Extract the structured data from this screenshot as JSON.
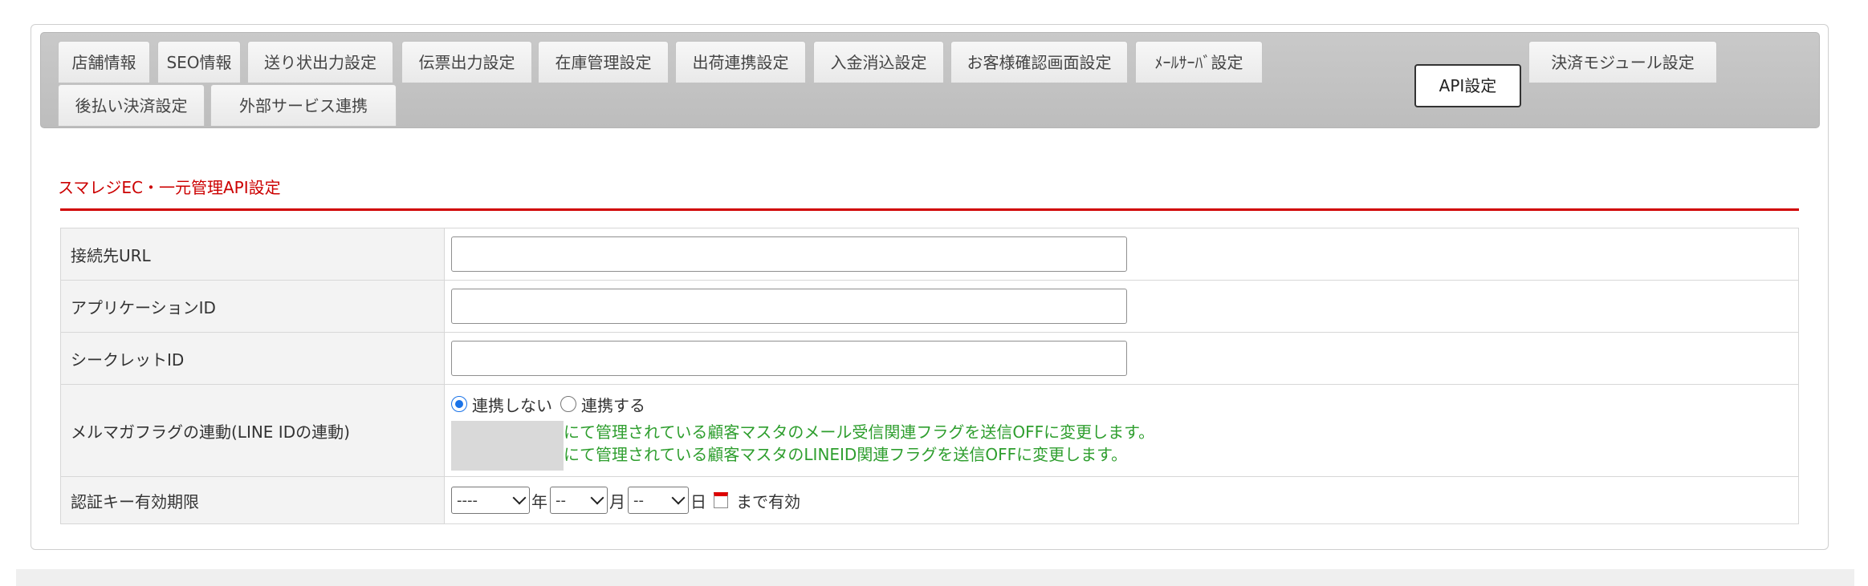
{
  "tabs": [
    {
      "label": "店舗情報",
      "active": false
    },
    {
      "label": "SEO情報",
      "active": false
    },
    {
      "label": "送り状出力設定",
      "active": false
    },
    {
      "label": "伝票出力設定",
      "active": false
    },
    {
      "label": "在庫管理設定",
      "active": false
    },
    {
      "label": "出荷連携設定",
      "active": false
    },
    {
      "label": "入金消込設定",
      "active": false
    },
    {
      "label": "お客様確認画面設定",
      "active": false
    },
    {
      "label": "ﾒｰﾙｻｰﾊﾞ設定",
      "active": false
    },
    {
      "label": "API設定",
      "active": true
    },
    {
      "label": "決済モジュール設定",
      "active": false
    },
    {
      "label": "後払い決済設定",
      "active": false
    },
    {
      "label": "外部サービス連携",
      "active": false
    }
  ],
  "section_title": "スマレジEC・一元管理API設定",
  "form": {
    "url_label": "接続先URL",
    "url_value": "",
    "app_id_label": "アプリケーションID",
    "app_id_value": "",
    "secret_label": "シークレットID",
    "secret_value": "",
    "mailmag_label": "メルマガフラグの連動(LINE IDの連動)",
    "radio_no": "連携しない",
    "radio_yes": "連携する",
    "radio_selected": "連携しない",
    "note_line1": "にて管理されている顧客マスタのメール受信関連フラグを送信OFFに変更します。",
    "note_line2": "にて管理されている顧客マスタのLINEID関連フラグを送信OFFに変更します。",
    "expiry_label": "認証キー有効期限",
    "year_value": "----",
    "year_unit": "年",
    "month_value": "--",
    "month_unit": "月",
    "day_value": "--",
    "day_unit": "日",
    "expiry_suffix": "まで有効"
  },
  "colors": {
    "section_title": "#cc0000",
    "rule": "#d00000",
    "note_text": "#2e9e2e",
    "radio_accent": "#1a73e8"
  },
  "icons": {
    "calendar": "calendar-icon",
    "select_arrow": "chevron-down-icon"
  }
}
